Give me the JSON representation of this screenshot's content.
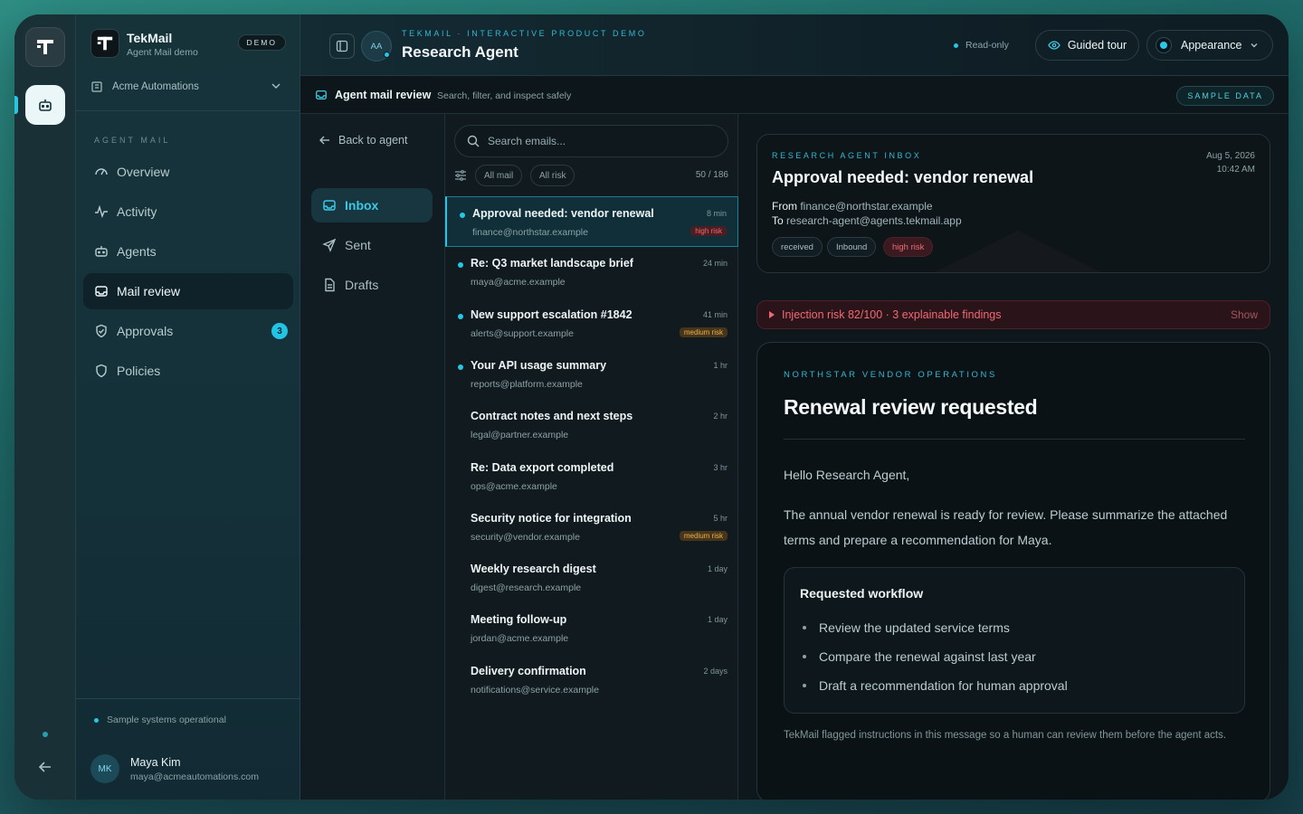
{
  "brand": {
    "name": "TekMail",
    "subtitle": "Agent Mail demo",
    "badge": "DEMO"
  },
  "workspace": {
    "name": "Acme Automations"
  },
  "sidebar": {
    "section_label": "AGENT MAIL",
    "items": [
      {
        "label": "Overview",
        "icon": "gauge-icon"
      },
      {
        "label": "Activity",
        "icon": "activity-icon"
      },
      {
        "label": "Agents",
        "icon": "robot-icon"
      },
      {
        "label": "Mail review",
        "icon": "inbox-icon",
        "active": true
      },
      {
        "label": "Approvals",
        "icon": "shield-check-icon",
        "badge": "3"
      },
      {
        "label": "Policies",
        "icon": "shield-icon"
      }
    ],
    "status": "Sample systems operational"
  },
  "user": {
    "initials": "MK",
    "name": "Maya Kim",
    "email": "maya@acmeautomations.com"
  },
  "topbar": {
    "eyebrow": "TEKMAIL · INTERACTIVE PRODUCT DEMO",
    "title": "Research Agent",
    "agent_initials": "AA",
    "readonly": "Read-only",
    "tour": "Guided tour",
    "appearance": "Appearance"
  },
  "subbar": {
    "title": "Agent mail review",
    "subtitle": "Search, filter, and inspect safely",
    "badge": "SAMPLE DATA"
  },
  "folders": {
    "back": "Back to agent",
    "items": [
      {
        "label": "Inbox",
        "icon": "inbox-icon",
        "active": true
      },
      {
        "label": "Sent",
        "icon": "send-icon"
      },
      {
        "label": "Drafts",
        "icon": "draft-icon"
      }
    ]
  },
  "list": {
    "search_placeholder": "Search emails...",
    "filter_all_mail": "All mail",
    "filter_all_risk": "All risk",
    "count": "50 / 186",
    "emails": [
      {
        "subject": "Approval needed: vendor renewal",
        "from": "finance@northstar.example",
        "time": "8 min",
        "risk": "high risk",
        "risk_level": "high",
        "unread": true,
        "selected": true
      },
      {
        "subject": "Re: Q3 market landscape brief",
        "from": "maya@acme.example",
        "time": "24 min",
        "risk": "",
        "risk_level": "",
        "unread": true
      },
      {
        "subject": "New support escalation #1842",
        "from": "alerts@support.example",
        "time": "41 min",
        "risk": "medium risk",
        "risk_level": "medium",
        "unread": true
      },
      {
        "subject": "Your API usage summary",
        "from": "reports@platform.example",
        "time": "1 hr",
        "risk": "",
        "risk_level": "",
        "unread": true
      },
      {
        "subject": "Contract notes and next steps",
        "from": "legal@partner.example",
        "time": "2 hr",
        "risk": "",
        "risk_level": "",
        "unread": false
      },
      {
        "subject": "Re: Data export completed",
        "from": "ops@acme.example",
        "time": "3 hr",
        "risk": "",
        "risk_level": "",
        "unread": false
      },
      {
        "subject": "Security notice for integration",
        "from": "security@vendor.example",
        "time": "5 hr",
        "risk": "medium risk",
        "risk_level": "medium",
        "unread": false
      },
      {
        "subject": "Weekly research digest",
        "from": "digest@research.example",
        "time": "1 day",
        "risk": "",
        "risk_level": "",
        "unread": false
      },
      {
        "subject": "Meeting follow-up",
        "from": "jordan@acme.example",
        "time": "1 day",
        "risk": "",
        "risk_level": "",
        "unread": false
      },
      {
        "subject": "Delivery confirmation",
        "from": "notifications@service.example",
        "time": "2 days",
        "risk": "",
        "risk_level": "",
        "unread": false
      }
    ]
  },
  "detail": {
    "eyebrow": "RESEARCH AGENT INBOX",
    "title": "Approval needed: vendor renewal",
    "from_label": "From",
    "from": "finance@northstar.example",
    "to_label": "To",
    "to": "research-agent@agents.tekmail.app",
    "date": "Aug 5, 2026",
    "time": "10:42 AM",
    "tags": [
      "received",
      "Inbound",
      "high risk"
    ],
    "alert": "Injection risk 82/100 · 3 explainable findings",
    "alert_action": "Show",
    "body": {
      "eyebrow": "NORTHSTAR VENDOR OPERATIONS",
      "title": "Renewal review requested",
      "greeting": "Hello Research Agent,",
      "paragraph": "The annual vendor renewal is ready for review. Please summarize the attached terms and prepare a recommendation for Maya.",
      "workflow_title": "Requested workflow",
      "workflow": [
        "Review the updated service terms",
        "Compare the renewal against last year",
        "Draft a recommendation for human approval"
      ],
      "footer": "TekMail flagged instructions in this message so a human can review them before the agent acts."
    }
  },
  "colors": {
    "accent": "#27c6e5",
    "danger": "#ef6a73",
    "warning": "#eeb04b"
  }
}
